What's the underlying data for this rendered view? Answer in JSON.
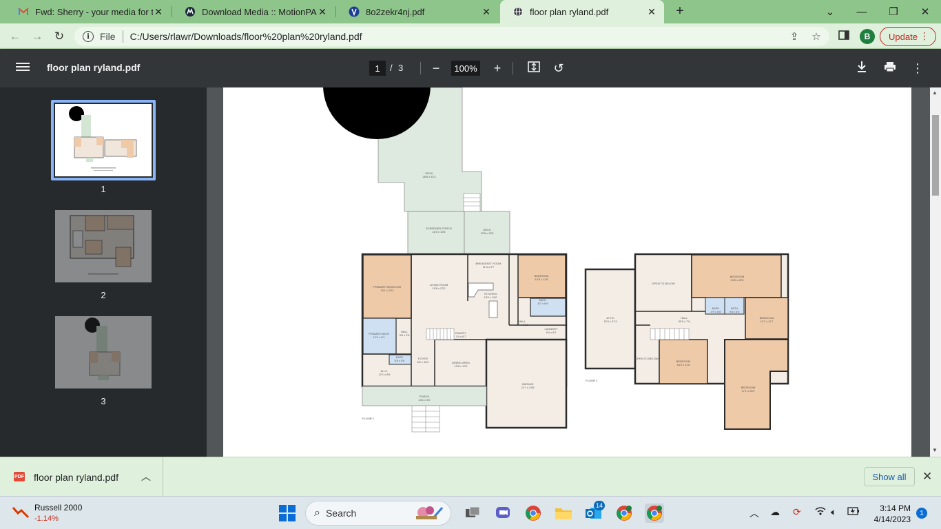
{
  "browser": {
    "tabs": [
      {
        "title": "Fwd: Sherry - your media for the",
        "icon": "gmail-icon",
        "active": false
      },
      {
        "title": "Download Media :: MotionPADs",
        "icon": "motionpads-icon",
        "active": false
      },
      {
        "title": "8o2zekr4nj.pdf",
        "icon": "pdf-site-icon",
        "active": false
      },
      {
        "title": "floor plan ryland.pdf",
        "icon": "globe-icon",
        "active": true
      }
    ],
    "new_tab_label": "+",
    "omnibox": {
      "scheme_label": "File",
      "url": "C:/Users/rlawr/Downloads/floor%20plan%20ryland.pdf"
    },
    "profile_initial": "B",
    "update_label": "Update",
    "accent_color": "#8ec58b"
  },
  "pdf_viewer": {
    "file_name": "floor plan ryland.pdf",
    "current_page": "1",
    "page_separator": "/",
    "total_pages": "3",
    "zoom": "100%",
    "thumbnails": [
      {
        "number": "1",
        "selected": true
      },
      {
        "number": "2",
        "selected": false
      },
      {
        "number": "3",
        "selected": false
      }
    ]
  },
  "floor_plan": {
    "floor1_label": "FLOOR 1",
    "floor2_label": "FLOOR 2",
    "rooms_floor1": [
      {
        "name": "DECK",
        "dims": "28'8 x 32'3"
      },
      {
        "name": "SCREENED PORCH",
        "dims": "16'3 x 15'5"
      },
      {
        "name": "DECK",
        "dims": "12'8 x 13'0"
      },
      {
        "name": "PRIMARY BEDROOM",
        "dims": "15'1 x 20'2"
      },
      {
        "name": "LIVING ROOM",
        "dims": "15'8 x 20'2"
      },
      {
        "name": "BREAKFAST ROOM",
        "dims": "11'3 x 9'7"
      },
      {
        "name": "BEDROOM",
        "dims": "13'3 x 11'8"
      },
      {
        "name": "KITCHEN",
        "dims": "13'0 x 16'0"
      },
      {
        "name": "BATH",
        "dims": "8'7 x 6'9"
      },
      {
        "name": "HALL",
        "dims": "7'4 x 10'6"
      },
      {
        "name": "LAUNDRY",
        "dims": "8'4 x 6'2"
      },
      {
        "name": "PANTRY",
        "dims": "3'4 x 5'7"
      },
      {
        "name": "HALL",
        "dims": "3'8 x 3'5"
      },
      {
        "name": "PRIMARY BATH",
        "dims": "12'0 x 8'1"
      },
      {
        "name": "BATH",
        "dims": "5'8 x 5'6"
      },
      {
        "name": "FOYER",
        "dims": "6'0 x 16'2"
      },
      {
        "name": "DINING AREA",
        "dims": "13'8 x 12'5"
      },
      {
        "name": "W.I.C.",
        "dims": "12'1 x 8'8"
      },
      {
        "name": "GARAGE",
        "dims": "21'7 x 23'8"
      },
      {
        "name": "PORCH",
        "dims": "34'1 x 5'0"
      }
    ],
    "rooms_floor2": [
      {
        "name": "OPEN TO BELOW",
        "dims": ""
      },
      {
        "name": "BEDROOM",
        "dims": "24'5 x 15'5"
      },
      {
        "name": "ATTIC",
        "dims": "15'3 x 27'4"
      },
      {
        "name": "BATH",
        "dims": "4'9 x 6'8"
      },
      {
        "name": "BATH",
        "dims": "9'8 x 6'0"
      },
      {
        "name": "HALL",
        "dims": "30'0 x 7'6"
      },
      {
        "name": "BEDROOM",
        "dims": "11'7 x 11'7"
      },
      {
        "name": "OPEN TO BELOW",
        "dims": ""
      },
      {
        "name": "BEDROOM",
        "dims": "15'3 x 11'8"
      },
      {
        "name": "BEDROOM",
        "dims": "17'1 x 26'2"
      }
    ],
    "colors": {
      "wall": "#2b2b2b",
      "room": "#f3ede6",
      "bedroom": "#eecaa8",
      "outdoor": "#deeadf",
      "bath": "#cfe0f3"
    }
  },
  "downloads": {
    "file_name": "floor plan ryland.pdf",
    "file_badge": "PDF",
    "show_all_label": "Show all"
  },
  "taskbar": {
    "ticker_name": "Russell 2000",
    "ticker_change": "-1.14%",
    "search_label": "Search",
    "badge_count": "14",
    "time": "3:14 PM",
    "date": "4/14/2023",
    "notification_count": "1"
  }
}
